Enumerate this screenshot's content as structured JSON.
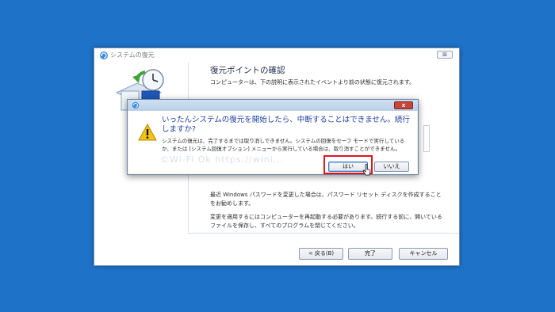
{
  "wizard": {
    "title": "システムの復元",
    "close_glyph": "⊠",
    "heading": "復元ポイントの確認",
    "subtext": "コンピューターは、下の説明に表示されたイベントより前の状態に復元されます。",
    "password_note": "最近 Windows パスワードを変更した場合は、パスワード リセット ディスクを作成することをお勧めします。",
    "restart_note": "変更を適用するにはコンピューターを再起動する必要があります。続行する前に、開いているファイルを保存し、すべてのプログラムを閉じてください。",
    "buttons": {
      "back": "< 戻る(B)",
      "finish": "完了",
      "cancel": "キャンセル"
    }
  },
  "dialog": {
    "close_glyph": "x",
    "main_message": "いったんシステムの復元を開始したら、中断することはできません。続行しますか?",
    "detail_message": "システムの復元は、完了するまでは取り消しできません。システムの回復をセーフ モードで実行しているか、または [システム回復オプション] メニューから実行している場合は、取り消すことができません。",
    "watermark": "©Wi-Fi.Ok    https://wini...",
    "buttons": {
      "yes": "はい",
      "no": "いいえ"
    }
  },
  "colors": {
    "desktop": "#1E73C9",
    "highlight": "#E0141B",
    "dialog_text": "#1C3FA0"
  },
  "icons": {
    "wizard_title": "system-restore-icon",
    "restore_illustration": "restore-illustration-icon",
    "warning": "warning-icon",
    "cursor": "mouse-pointer-icon"
  }
}
